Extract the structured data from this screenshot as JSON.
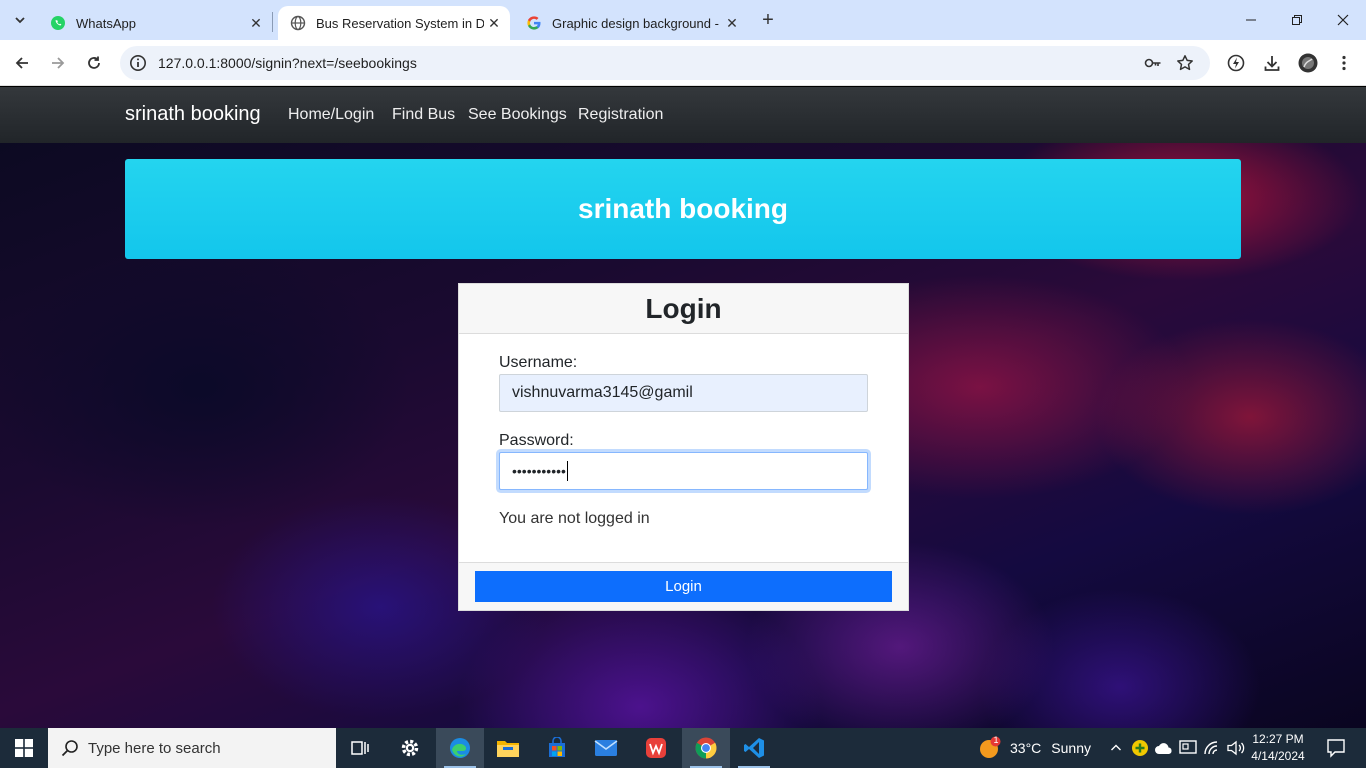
{
  "browser": {
    "tabs": [
      {
        "label": "WhatsApp",
        "active": false
      },
      {
        "label": "Bus Reservation System in Djan",
        "active": true
      },
      {
        "label": "Graphic design background - G",
        "active": false
      }
    ],
    "url": "127.0.0.1:8000/signin?next=/seebookings"
  },
  "site": {
    "brand": "srinath booking",
    "nav": [
      "Home/Login",
      "Find Bus",
      "See Bookings",
      "Registration"
    ],
    "jumbotron_title": "srinath booking"
  },
  "login": {
    "title": "Login",
    "username_label": "Username:",
    "username_value": "vishnuvarma3145@gamil",
    "password_label": "Password:",
    "password_mask": "•••••••••••",
    "status_text": "You are not logged in",
    "button_label": "Login"
  },
  "taskbar": {
    "search_placeholder": "Type here to search",
    "weather_temp": "33°C",
    "weather_text": "Sunny",
    "weather_badge": "1",
    "time": "12:27 PM",
    "date": "4/14/2024"
  },
  "colors": {
    "navbar": "#212529",
    "jumbotron": "#1fcdee",
    "primary_button": "#0d6efd",
    "tabbar": "#d3e3fd"
  }
}
